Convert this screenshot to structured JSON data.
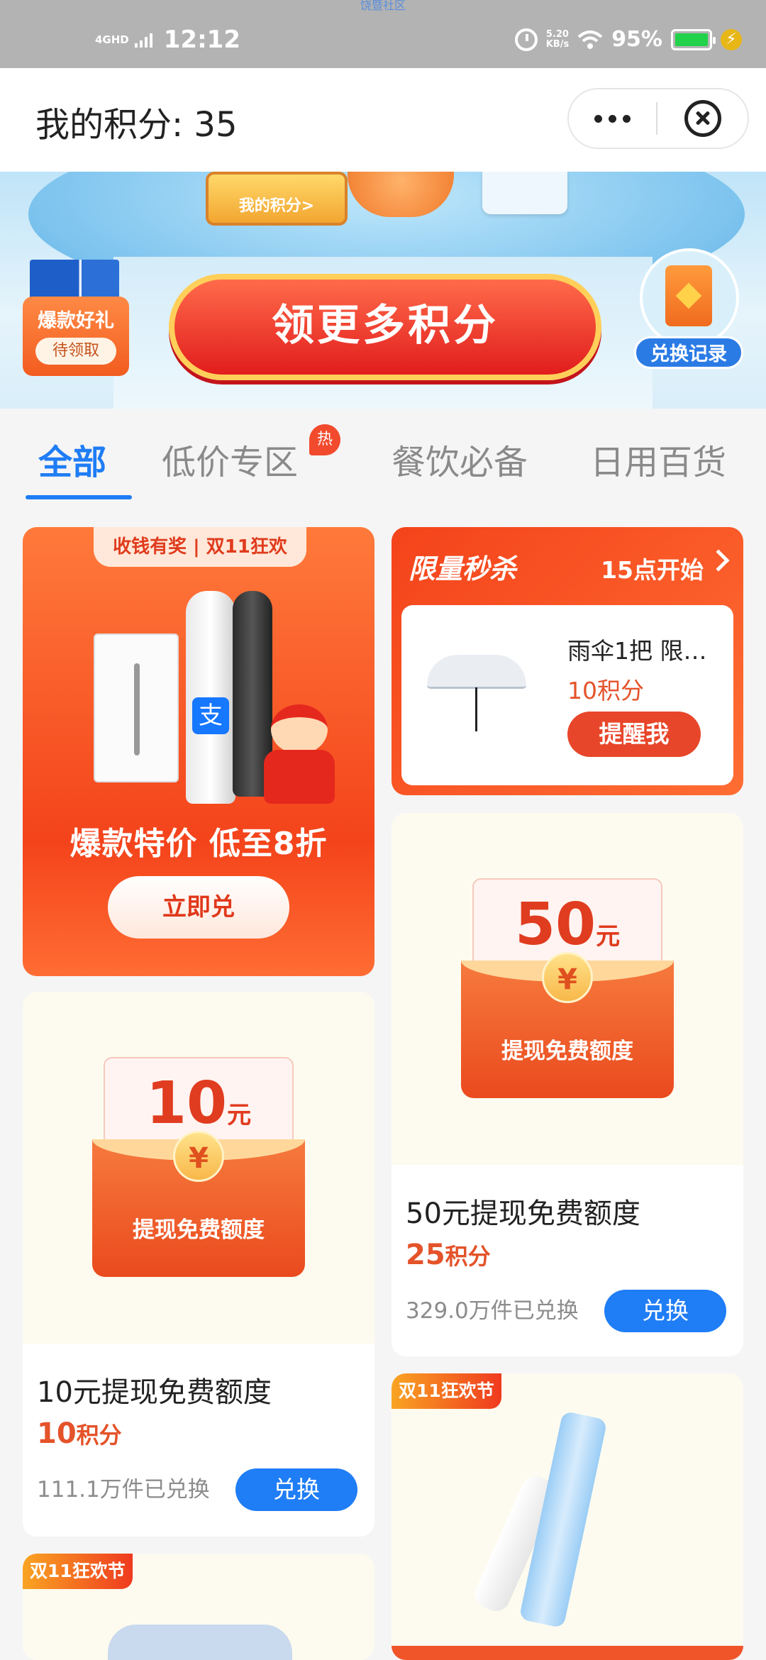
{
  "status_bar": {
    "top_label": "饶暨社区",
    "network": "4GHD",
    "time": "12:12",
    "speed": "5.20",
    "speed_unit": "KB/s",
    "battery": "95%"
  },
  "header": {
    "title": "我的积分: 35"
  },
  "banner": {
    "points_label": "我的积分>",
    "gift_title": "爆款好礼",
    "gift_badge": "待领取",
    "cta": "领更多积分",
    "record": "兑换记录"
  },
  "tabs": [
    {
      "label": "全部",
      "active": true
    },
    {
      "label": "低价专区",
      "badge": "热"
    },
    {
      "label": "餐饮必备"
    },
    {
      "label": "日用百货"
    }
  ],
  "promo": {
    "ribbon": "收钱有奖 | 双11狂欢",
    "logo_char": "支",
    "headline": "爆款特价 低至8折",
    "button": "立即兑"
  },
  "flash_sale": {
    "title": "限量秒杀",
    "start": "15点开始",
    "product": "雨伞1把 限…",
    "price": "10积分",
    "button": "提醒我"
  },
  "products": [
    {
      "amount": "50",
      "unit": "元",
      "coin": "¥",
      "envelope_label": "提现免费额度",
      "title": "50元提现免费额度",
      "price_num": "25",
      "price_unit": "积分",
      "sold": "329.0万件已兑换",
      "button": "兑换"
    },
    {
      "amount": "10",
      "unit": "元",
      "coin": "¥",
      "envelope_label": "提现免费额度",
      "title": "10元提现免费额度",
      "price_num": "10",
      "price_unit": "积分",
      "sold": "111.1万件已兑换",
      "button": "兑换"
    }
  ],
  "tags": {
    "cutter": "双11狂欢节",
    "mask": "双11狂欢节"
  },
  "colors": {
    "accent": "#1f7df5",
    "price": "#e4532a",
    "promo": "#f4431b"
  }
}
